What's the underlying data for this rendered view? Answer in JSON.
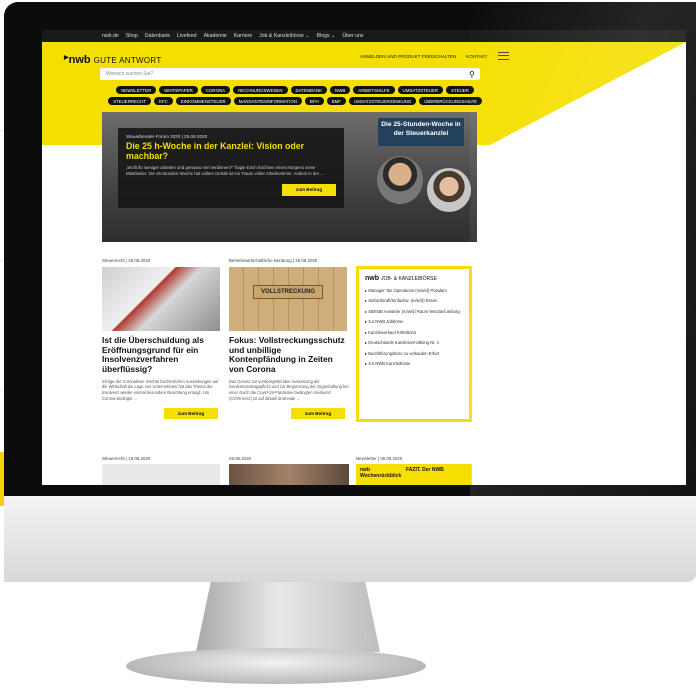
{
  "topnav": [
    "nwb.de",
    "Shop",
    "Datenbank",
    "Livefeed",
    "Akademie",
    "Karriere",
    "Job & Kanzleibörse ⌄",
    "Blogs ⌄",
    "Über uns"
  ],
  "header": {
    "logo": "nwb",
    "logo_sub": "GUTE ANTWORT",
    "login": "ANMELDEN UND PRODUKT FREISCHALTEN",
    "kontakt": "KONTAKT"
  },
  "search": {
    "placeholder": "Wonach suchen Sie?"
  },
  "tags": [
    "NEWSLETTER",
    "WHITEPAPER",
    "CORONA",
    "RECHNUNGSWESEN",
    "DATENBANK",
    "NWB",
    "ARBEITSHILFE",
    "UMSATZSTEUER",
    "STEUER",
    "STEUERRECHT",
    "KFC",
    "EINKOMMENSTEUER",
    "MANDANTENINFORMATION",
    "BFH",
    "BMF",
    "UMSATZSTEUERSENKUNG",
    "ÜBERBRÜCKUNGSHILFE"
  ],
  "hero": {
    "meta": "Steuerberater-Forum 2020 | 25.08.2020",
    "title": "Die 25 h-Woche in der Kanzlei: Vision oder machbar?",
    "text": "„Wollt ihr weniger arbeiten und genauso viel verdienen?\" fragte Erich Erichsen eines Morgens seine Mitarbeiter. Die 25-Stunden-Woche hat vollem Gehalt ist ein Traum vieler Arbeitnehmer. Anders in der ...",
    "button": "zum Beitrag",
    "promo": "Die 25-Stunden-Woche in der Steuerkanzlei"
  },
  "articles": [
    {
      "meta": "Steuerrecht | 25.08.2020",
      "title": "Ist die Überschuldung als Eröffnungsgrund für ein Insolvenzverfahren überflüssig?",
      "text": "Infolge der Coronakrise möchte fürchterlichen Auswirkungen auf die Wirtschaft die Lage von Unternehmen hat das Thema der Insolvenz wieder einmal besondere Beachtung erlangt. Um Corona-bedingte ...",
      "button": "zum Beitrag"
    },
    {
      "meta": "Betriebswirtschaftliche Beratung | 25.08.2020",
      "title": "Fokus: Vollstreckungsschutz und unbillige Kontenpfändung in Zeiten von Corona",
      "text": "Das Gesetz zur vorübergehenden Aussetzung der Insolvenzantragspflicht und zur Begrenzung der Organhaftung bei einer durch die Covid-19-Pandemie bedingten Insolvenz (COVInsAG) ist auf aktuell drohende ...",
      "button": "zum Beitrag",
      "image_label": "VOLLSTRECKUNG"
    }
  ],
  "sidebar": {
    "logo": "nwb",
    "title": "JOB- & KANZLEIBÖRSE",
    "items": [
      "Manager Tax Operations (m/w/d) Potsdam",
      "Sinfachkraft/Sinfachw. (m/w/d) Essen",
      "StB/StB Anwärter (m/w/d) Raum Wetzlar/Limburg",
      "zur NWB Jobbörse",
      "Kanzleiverkauf Köln/Bonn",
      "Deutschlands Kanzleivermittlung Nr. 1",
      "Buchführungsbüro zu verkaufen Erfurt",
      "zur NWB Kanzleibörse"
    ]
  },
  "bottom": {
    "meta1": "Steuerrecht | 19.08.2020",
    "meta2": "28.08.2020",
    "meta3": "Newsletter | 06.08.2020",
    "newsletter_logo": "nwb",
    "newsletter_title": "FAZIT. Der NWB Wochenrückblick"
  }
}
